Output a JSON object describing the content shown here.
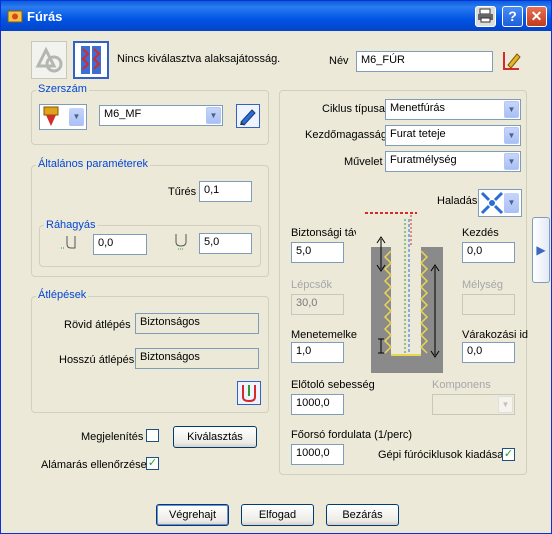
{
  "window": {
    "title": "Fúrás"
  },
  "header": {
    "status_text": "Nincs kiválasztva alaksajátosság.",
    "name_label": "Név",
    "name_value": "M6_FÚR"
  },
  "tool": {
    "group_title": "Szerszám",
    "tool_value": "M6_MF"
  },
  "general": {
    "group_title": "Általános paraméterek",
    "tolerance_label": "Tűrés",
    "tolerance_value": "0,1",
    "allowance_title": "Ráhagyás",
    "allowance_side_value": "0,0",
    "allowance_bottom_value": "5,0"
  },
  "transitions": {
    "group_title": "Átlépések",
    "short_label": "Rövid átlépés",
    "short_value": "Biztonságos",
    "long_label": "Hosszú átlépés",
    "long_value": "Biztonságos"
  },
  "bottom_left": {
    "display_label": "Megjelenítés",
    "select_button": "Kiválasztás",
    "undercut_label": "Alámarás ellenőrzése"
  },
  "cycle": {
    "cycle_type_label": "Ciklus típusa",
    "cycle_type_value": "Menetfúrás",
    "start_height_label": "Kezdőmagasság",
    "start_height_value": "Furat teteje",
    "operation_label": "Művelet",
    "operation_value": "Furatmélység",
    "progress_label": "Haladás",
    "safety_label": "Biztonsági távolság",
    "safety_value": "5,0",
    "start_label": "Kezdés",
    "start_value": "0,0",
    "steps_label": "Lépcsők",
    "steps_value": "30,0",
    "depth_label": "Mélység",
    "depth_value": "",
    "pitch_label": "Menetemelkedés",
    "pitch_value": "1,0",
    "dwell_label": "Várakozási idő",
    "dwell_value": "0,0",
    "feed_label": "Előtoló sebesség",
    "feed_value": "1000,0",
    "component_label": "Komponens",
    "component_value": "",
    "spindle_label": "Főorsó fordulata (1/perc)",
    "spindle_value": "1000,0",
    "machine_cycles_label": "Gépi fúróciklusok kiadása"
  },
  "footer": {
    "execute_button": "Végrehajt",
    "accept_button": "Elfogad",
    "close_button": "Bezárás"
  },
  "colors": {
    "titlebar": "#0055e5",
    "group_title": "#0046d5",
    "background": "#ece9d8",
    "check": "#21a121"
  }
}
